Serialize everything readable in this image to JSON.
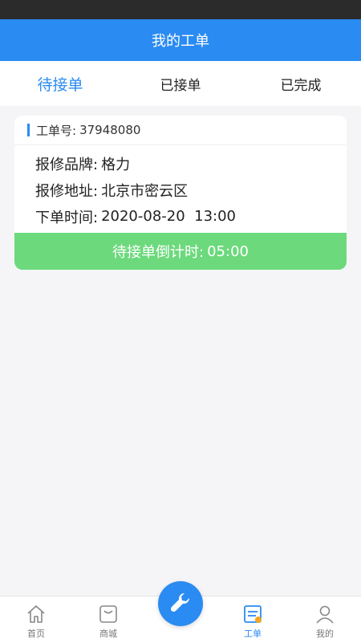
{
  "header": {
    "title": "我的工单"
  },
  "tabs": [
    {
      "label": "待接单"
    },
    {
      "label": "已接单"
    },
    {
      "label": "已完成"
    }
  ],
  "order": {
    "number_label": "工单号:",
    "number": "37948080",
    "brand_label": "报修品牌:",
    "brand": "格力",
    "address_label": "报修地址:",
    "address": "北京市密云区",
    "time_label": "下单时间:",
    "time": "2020-08-20  13:00",
    "countdown_label": "待接单倒计时:",
    "countdown": "05:00"
  },
  "tabbar": {
    "items": [
      {
        "label": "首页",
        "icon": "home-icon"
      },
      {
        "label": "商城",
        "icon": "shop-icon"
      },
      {
        "label": "",
        "icon": "wrench-icon"
      },
      {
        "label": "工单",
        "icon": "workorder-icon"
      },
      {
        "label": "我的",
        "icon": "user-icon"
      }
    ]
  },
  "colors": {
    "primary": "#2a8bf2",
    "countdown": "#6cd97c",
    "badge": "#f5a623"
  }
}
